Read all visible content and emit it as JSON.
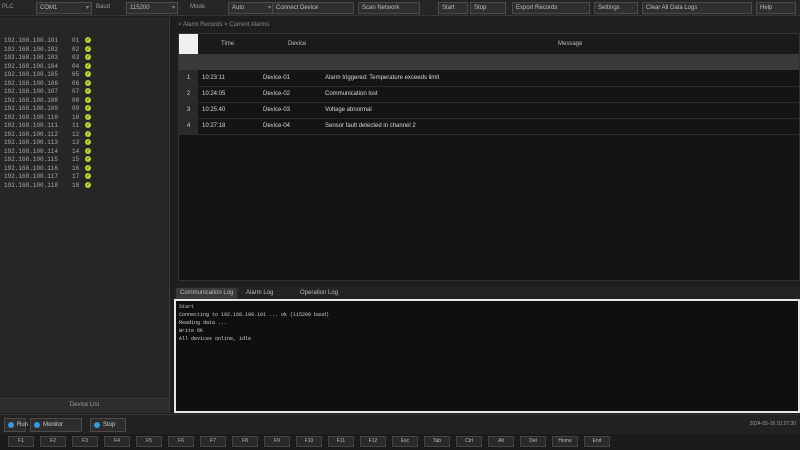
{
  "toolbar": {
    "items": [
      {
        "kind": "label",
        "text": "PLC"
      },
      {
        "kind": "select",
        "text": "COM1"
      },
      {
        "kind": "label",
        "text": "Baud"
      },
      {
        "kind": "select",
        "text": "115200"
      },
      {
        "kind": "label",
        "text": "Mode"
      },
      {
        "kind": "select",
        "text": "Auto"
      },
      {
        "kind": "button",
        "text": "Connect Device"
      },
      {
        "kind": "button",
        "text": "Scan Network"
      },
      {
        "kind": "button",
        "text": "Start"
      },
      {
        "kind": "button",
        "text": "Stop"
      },
      {
        "kind": "button",
        "text": "Export Records"
      },
      {
        "kind": "button",
        "text": "Settings"
      },
      {
        "kind": "button",
        "text": "Clear All Data Logs"
      },
      {
        "kind": "button",
        "text": "Help"
      }
    ]
  },
  "device_list": {
    "items": [
      {
        "ip": "192.168.100.101",
        "num": "01",
        "ok": true
      },
      {
        "ip": "192.168.100.102",
        "num": "02",
        "ok": true
      },
      {
        "ip": "192.168.100.103",
        "num": "03",
        "ok": true
      },
      {
        "ip": "192.168.100.104",
        "num": "04",
        "ok": true
      },
      {
        "ip": "192.168.100.105",
        "num": "05",
        "ok": true
      },
      {
        "ip": "192.168.100.106",
        "num": "06",
        "ok": true
      },
      {
        "ip": "192.168.100.107",
        "num": "07",
        "ok": true
      },
      {
        "ip": "192.168.100.108",
        "num": "08",
        "ok": true
      },
      {
        "ip": "192.168.100.109",
        "num": "09",
        "ok": true
      },
      {
        "ip": "192.168.100.110",
        "num": "10",
        "ok": true
      },
      {
        "ip": "192.168.100.111",
        "num": "11",
        "ok": true
      },
      {
        "ip": "192.168.100.112",
        "num": "12",
        "ok": true
      },
      {
        "ip": "192.168.100.113",
        "num": "13",
        "ok": true
      },
      {
        "ip": "192.168.100.114",
        "num": "14",
        "ok": true
      },
      {
        "ip": "192.168.100.115",
        "num": "15",
        "ok": true
      },
      {
        "ip": "192.168.100.116",
        "num": "16",
        "ok": true
      },
      {
        "ip": "192.168.100.117",
        "num": "17",
        "ok": true
      },
      {
        "ip": "192.168.100.118",
        "num": "18",
        "ok": true
      }
    ],
    "footer": "Device List"
  },
  "breadcrumb": "> Alarm Records > Current Alarms",
  "table": {
    "columns": [
      "Time",
      "Device",
      "Message"
    ],
    "rows": [
      {
        "num": "1",
        "time": "10:23:11",
        "device": "Device-01",
        "msg": "Alarm triggered: Temperature exceeds limit"
      },
      {
        "num": "2",
        "time": "10:24:05",
        "device": "Device-02",
        "msg": "Communication lost"
      },
      {
        "num": "3",
        "time": "10:25:40",
        "device": "Device-03",
        "msg": "Voltage abnormal"
      },
      {
        "num": "4",
        "time": "10:27:18",
        "device": "Device-04",
        "msg": "Sensor fault detected in channel 2"
      }
    ]
  },
  "tabs": [
    "Communication Log",
    "Alarm Log",
    "Operation Log"
  ],
  "console_lines": [
    "Start",
    "Connecting to 192.168.100.101 ... ok (115200 baud)",
    "Reading data ...",
    "Write OK",
    "All devices online, idle"
  ],
  "statusbar": {
    "buttons": [
      "Run",
      "Monitor",
      "Stop"
    ],
    "right_text": "2024-05-16 10:27:30"
  },
  "keys": [
    "F1",
    "F2",
    "F3",
    "F4",
    "F5",
    "F6",
    "F7",
    "F8",
    "F9",
    "F10",
    "F11",
    "F12",
    "Esc",
    "Tab",
    "Ctrl",
    "Alt",
    "Del",
    "Home",
    "End"
  ]
}
